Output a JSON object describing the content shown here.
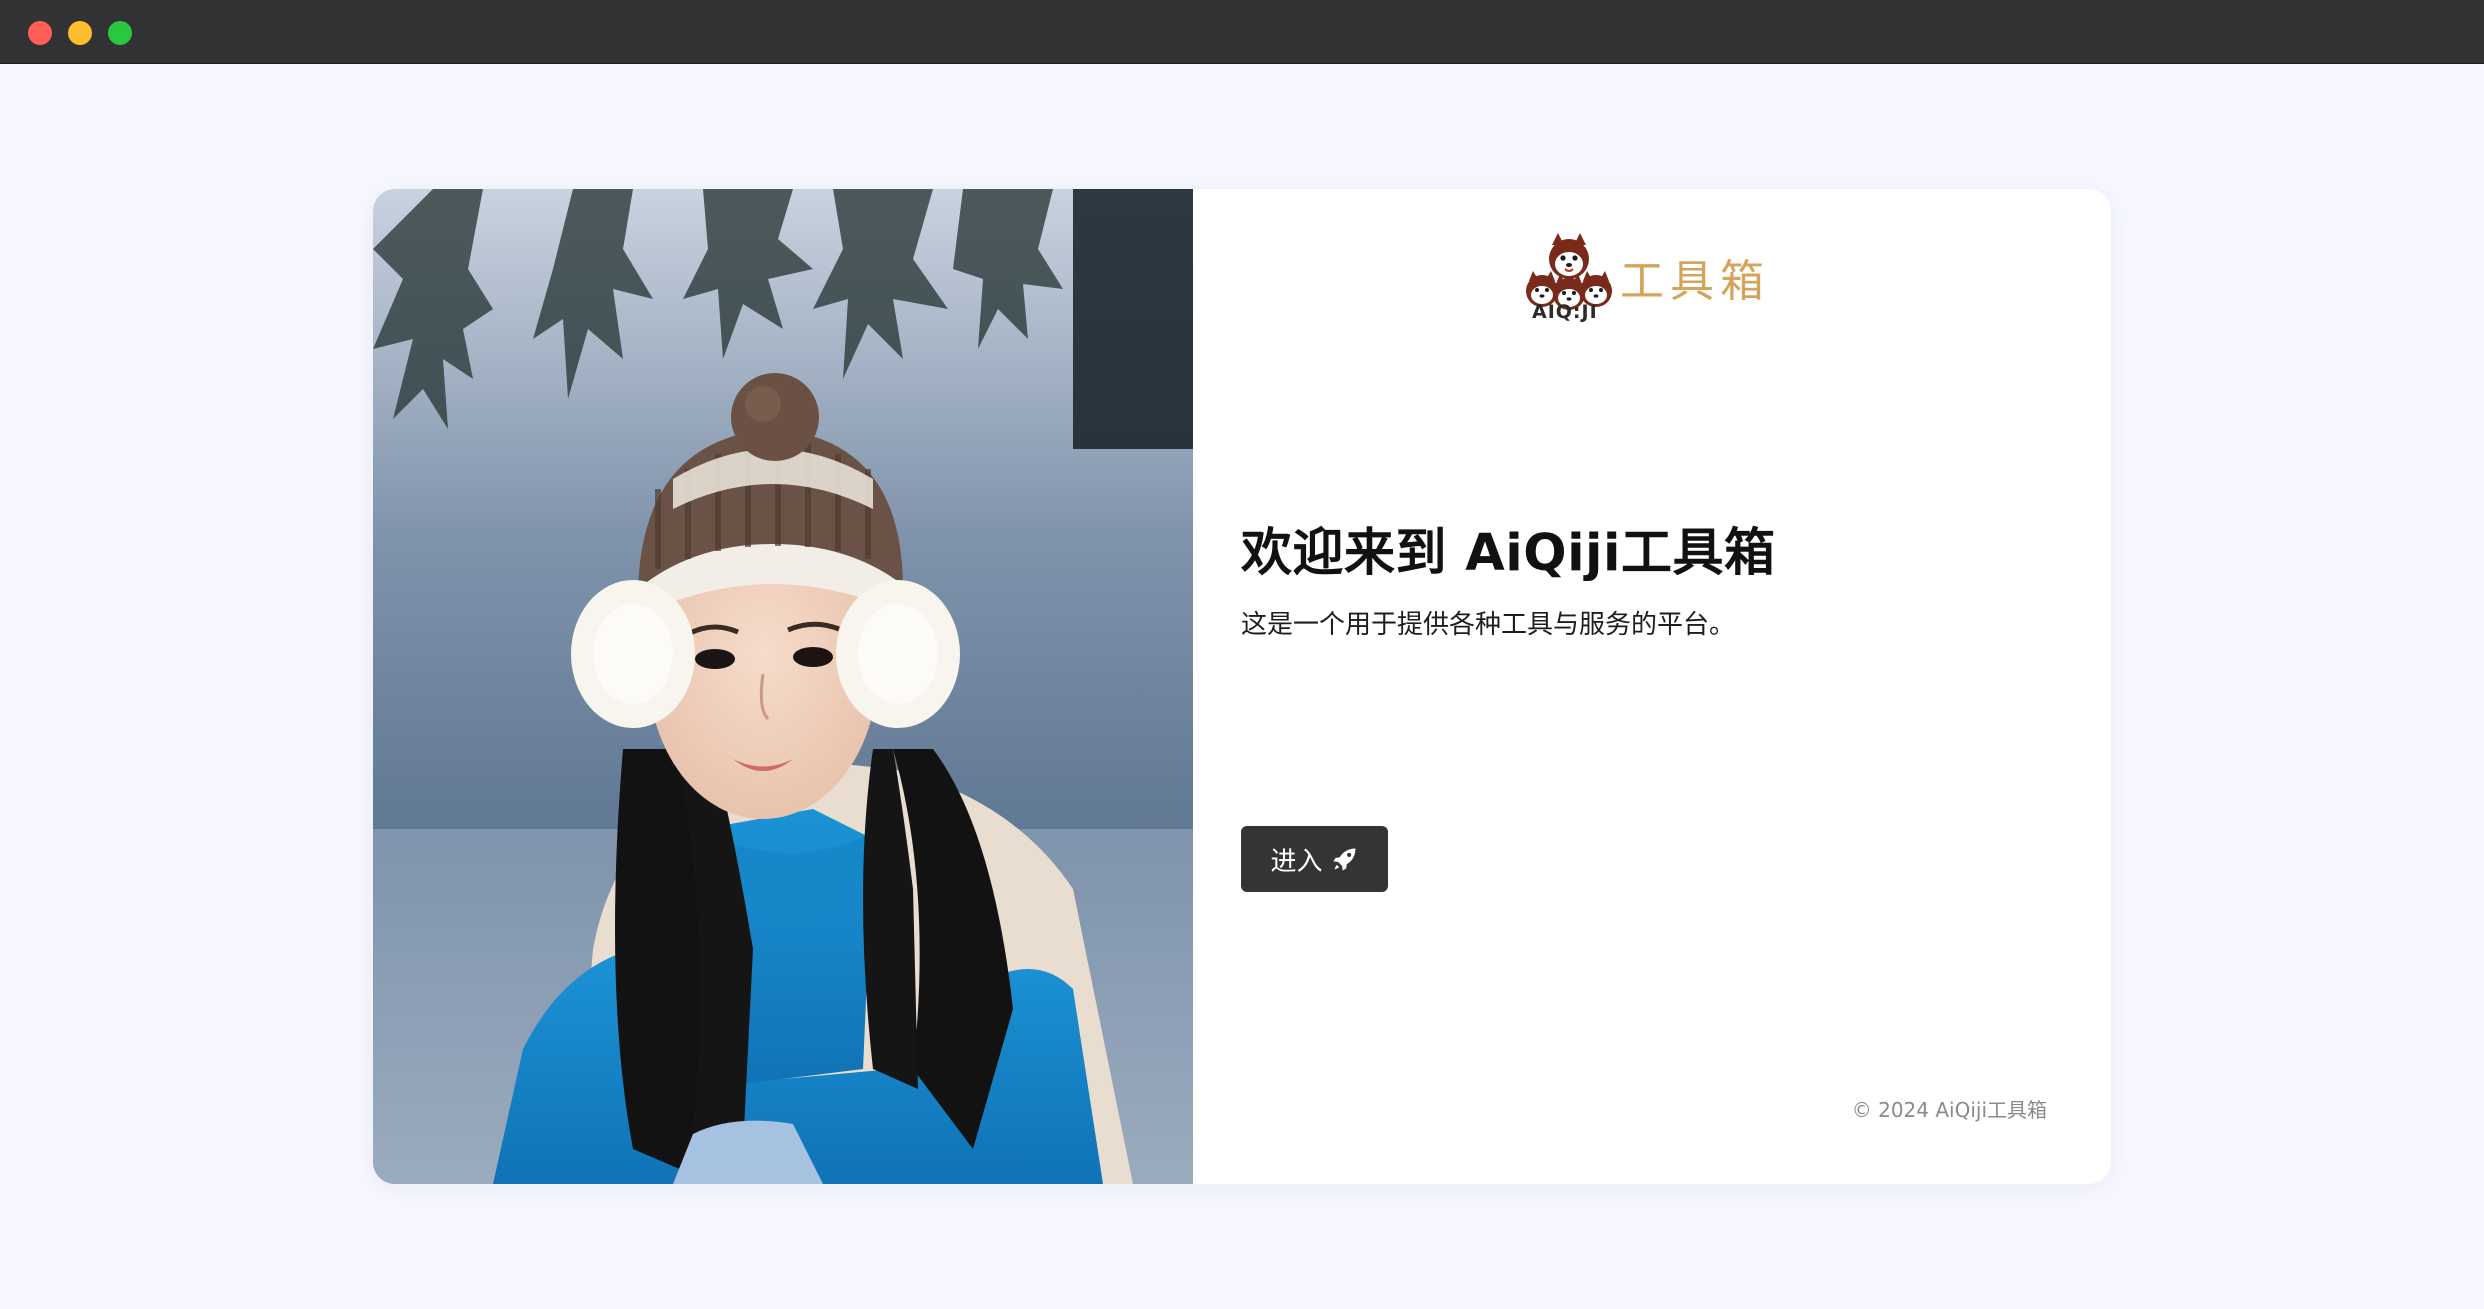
{
  "window": {
    "controls": [
      "close",
      "minimize",
      "maximize"
    ]
  },
  "hero_image": {
    "description_icon": "photo-woman-in-snow"
  },
  "brand": {
    "logo_word": "AIQ:JI",
    "logo_title": "工具箱",
    "accent_color": "#d4a35c"
  },
  "welcome": {
    "title": "欢迎来到 AiQiji工具箱",
    "subtitle": "这是一个用于提供各种工具与服务的平台。"
  },
  "enter_button": {
    "label": "进入",
    "icon": "rocket-icon",
    "color": "#343434"
  },
  "footer": {
    "copyright": "© 2024 AiQiji工具箱"
  }
}
